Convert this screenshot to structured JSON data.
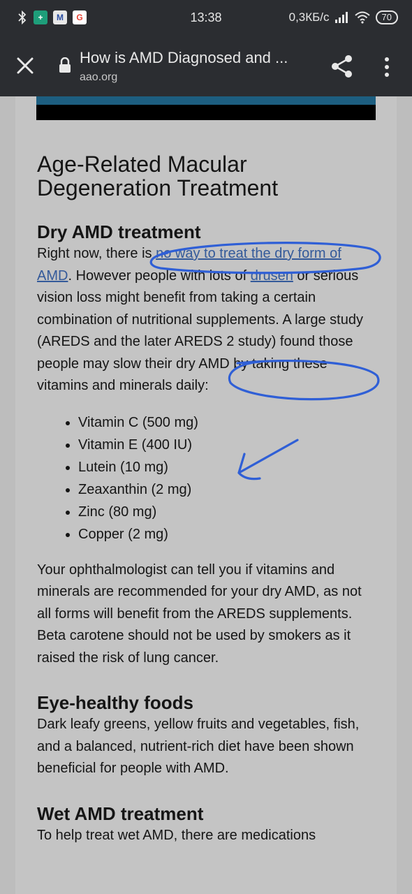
{
  "status_bar": {
    "time": "13:38",
    "network_speed": "0,3КБ/с",
    "battery": "70",
    "icons": [
      "bluetooth-icon",
      "app-icon",
      "mail-icon",
      "google-icon",
      "signal-icon",
      "wifi-icon"
    ]
  },
  "browser": {
    "title": "How is AMD Diagnosed and ...",
    "domain": "aao.org"
  },
  "article": {
    "heading": "Age-Related Macular Degeneration Treatment",
    "dry": {
      "heading": "Dry AMD treatment",
      "p1_a": "Right now, there is ",
      "p1_link1": "no way to treat the dry form of AMD",
      "p1_b": ". However people with lots of ",
      "p1_link2": "drusen",
      "p1_c": " or serious vision loss might benefit from taking a certain combination of nutritional supplements. A large study (AREDS and the later AREDS 2 study) found those people may slow their dry AMD by taking these vitamins and minerals daily:",
      "supplements": [
        "Vitamin C (500 mg)",
        "Vitamin E (400 IU)",
        "Lutein (10 mg)",
        "Zeaxanthin (2 mg)",
        "Zinc (80 mg)",
        "Copper (2 mg)"
      ],
      "p2": "Your ophthalmologist can tell you if vitamins and minerals are recommended for your dry AMD, as not all forms will benefit from the AREDS supplements. Beta carotene should not be used by smokers as it raised the risk of lung cancer."
    },
    "foods": {
      "heading": "Eye-healthy foods",
      "text": "Dark leafy greens, yellow fruits and vegetables, fish, and a balanced, nutrient-rich diet have been shown beneficial for people with AMD."
    },
    "wet": {
      "heading": "Wet AMD treatment",
      "text": "To help treat wet AMD, there are medications"
    }
  },
  "colors": {
    "annotation_ink": "#2f5fd6",
    "link": "#345a9a",
    "toolbar": "#2b2d31"
  }
}
